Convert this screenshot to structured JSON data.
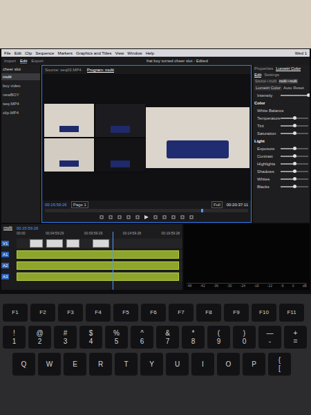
{
  "menubar": {
    "items": [
      "File",
      "Edit",
      "Clip",
      "Sequence",
      "Markers",
      "Graphics and Titles",
      "View",
      "Window",
      "Help"
    ],
    "clock": "Wed 1"
  },
  "window": {
    "title": "frat boy turned cheer slut - Edited"
  },
  "workspace_tabs": [
    {
      "label": "Import",
      "selected": false
    },
    {
      "label": "Edit",
      "selected": true
    },
    {
      "label": "Export",
      "selected": false
    }
  ],
  "project": {
    "header": "cheer slut",
    "items": [
      {
        "label": "multi",
        "selected": true
      },
      {
        "label": "boy video",
        "selected": false
      },
      {
        "label": "newBOY",
        "selected": false
      },
      {
        "label": "seq.MP4",
        "selected": false
      },
      {
        "label": "clip.MP4",
        "selected": false
      }
    ]
  },
  "monitor": {
    "tabs": [
      {
        "label": "Source: seq03.MP4",
        "selected": false
      },
      {
        "label": "Program: multi",
        "selected": true
      }
    ],
    "timecode": "00:15:59:26",
    "page": "Page 1",
    "zoom": "Full",
    "duration": "00:20:37:11",
    "playhead": 0.77
  },
  "properties": {
    "tabs": [
      {
        "label": "Properties",
        "selected": false
      },
      {
        "label": "Lumetri Color",
        "selected": true
      }
    ],
    "subtabs": [
      {
        "label": "Edit",
        "selected": true
      },
      {
        "label": "Settings",
        "selected": false
      }
    ],
    "selectors": [
      {
        "label": "Source • multi",
        "selected": false
      },
      {
        "label": "multi • multi",
        "selected": true
      }
    ],
    "effect": "Lumetri Color",
    "buttons": [
      "Auto",
      "Reset"
    ],
    "rows": [
      {
        "kind": "slider",
        "label": "Intensity",
        "level": 1.0
      },
      {
        "kind": "section",
        "label": "Color"
      },
      {
        "kind": "label",
        "label": "White Balance"
      },
      {
        "kind": "slider",
        "label": "Temperature",
        "level": 0.5
      },
      {
        "kind": "slider",
        "label": "Tint",
        "level": 0.5
      },
      {
        "kind": "slider",
        "label": "Saturation",
        "level": 0.5
      },
      {
        "kind": "section",
        "label": "Light"
      },
      {
        "kind": "slider",
        "label": "Exposure",
        "level": 0.5
      },
      {
        "kind": "slider",
        "label": "Contrast",
        "level": 0.5
      },
      {
        "kind": "slider",
        "label": "Highlights",
        "level": 0.5
      },
      {
        "kind": "slider",
        "label": "Shadows",
        "level": 0.5
      },
      {
        "kind": "slider",
        "label": "Whites",
        "level": 0.5
      },
      {
        "kind": "slider",
        "label": "Blacks",
        "level": 0.5
      }
    ]
  },
  "timeline": {
    "sequence": "multi",
    "timecode": "00:15:59:26",
    "ruler": [
      "00:00",
      "00:04:59:29",
      "00:09:59:29",
      "00:14:59:28",
      "00:19:59:28"
    ],
    "playhead": 0.58,
    "tracks": [
      {
        "label": "V1",
        "kind": "video",
        "clips": [
          {
            "start": 0.08,
            "end": 0.16
          },
          {
            "start": 0.18,
            "end": 0.28
          },
          {
            "start": 0.3,
            "end": 0.38
          },
          {
            "start": 0.46,
            "end": 0.56
          }
        ]
      },
      {
        "label": "A1",
        "kind": "audio",
        "clips": [
          {
            "start": 0.0,
            "end": 0.98
          }
        ]
      },
      {
        "label": "A2",
        "kind": "audio",
        "clips": [
          {
            "start": 0.0,
            "end": 0.98
          }
        ]
      },
      {
        "label": "A3",
        "kind": "audio",
        "clips": [
          {
            "start": 0.0,
            "end": 0.98
          }
        ]
      }
    ]
  },
  "meter": {
    "scale": [
      "-48",
      "-42",
      "-36",
      "-30",
      "-24",
      "-18",
      "-12",
      "-6",
      "0",
      "dB"
    ]
  },
  "keyboard": {
    "rows": [
      [
        {
          "top": "",
          "bottom": "F1"
        },
        {
          "top": "",
          "bottom": "F2"
        },
        {
          "top": "",
          "bottom": "F3"
        },
        {
          "top": "",
          "bottom": "F4"
        },
        {
          "top": "",
          "bottom": "F5"
        },
        {
          "top": "",
          "bottom": "F6"
        },
        {
          "top": "",
          "bottom": "F7"
        },
        {
          "top": "",
          "bottom": "F8"
        },
        {
          "top": "",
          "bottom": "F9"
        },
        {
          "top": "",
          "bottom": "F10"
        },
        {
          "top": "",
          "bottom": "F11"
        }
      ],
      [
        {
          "top": "!",
          "bottom": "1"
        },
        {
          "top": "@",
          "bottom": "2"
        },
        {
          "top": "#",
          "bottom": "3"
        },
        {
          "top": "$",
          "bottom": "4"
        },
        {
          "top": "%",
          "bottom": "5"
        },
        {
          "top": "^",
          "bottom": "6"
        },
        {
          "top": "&",
          "bottom": "7"
        },
        {
          "top": "*",
          "bottom": "8"
        },
        {
          "top": "(",
          "bottom": "9"
        },
        {
          "top": ")",
          "bottom": "0"
        },
        {
          "top": "—",
          "bottom": "-"
        },
        {
          "top": "+",
          "bottom": "="
        }
      ],
      [
        {
          "top": "",
          "bottom": "Q"
        },
        {
          "top": "",
          "bottom": "W"
        },
        {
          "top": "",
          "bottom": "E"
        },
        {
          "top": "",
          "bottom": "R"
        },
        {
          "top": "",
          "bottom": "T"
        },
        {
          "top": "",
          "bottom": "Y"
        },
        {
          "top": "",
          "bottom": "U"
        },
        {
          "top": "",
          "bottom": "I"
        },
        {
          "top": "",
          "bottom": "O"
        },
        {
          "top": "",
          "bottom": "P"
        },
        {
          "top": "{",
          "bottom": "["
        }
      ]
    ]
  }
}
